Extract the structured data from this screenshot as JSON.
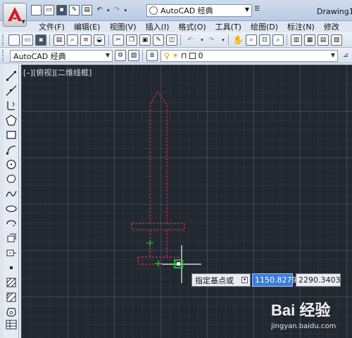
{
  "titlebar": {
    "workspace": "AutoCAD 经典",
    "document_title": "Drawing1."
  },
  "menu": [
    "文件(F)",
    "编辑(E)",
    "视图(V)",
    "插入(I)",
    "格式(O)",
    "工具(T)",
    "绘图(D)",
    "标注(N)",
    "修改"
  ],
  "toolbars": {
    "workspace_combo": "AutoCAD 经典",
    "layer_name": "0"
  },
  "canvas": {
    "viewport_label": "[–][俯视][二维线框]",
    "prompt_label": "指定基点或",
    "coord_x": "1150.8279",
    "coord_y": "2290.3403"
  },
  "watermark": {
    "logo": "Bai 经验",
    "url": "jingyan.baidu.com"
  },
  "colors": {
    "canvas_bg": "#212830",
    "dashed_outline": "#c0293d",
    "grip_green": "#1cc43a",
    "input_highlight": "#3b7ed9"
  }
}
